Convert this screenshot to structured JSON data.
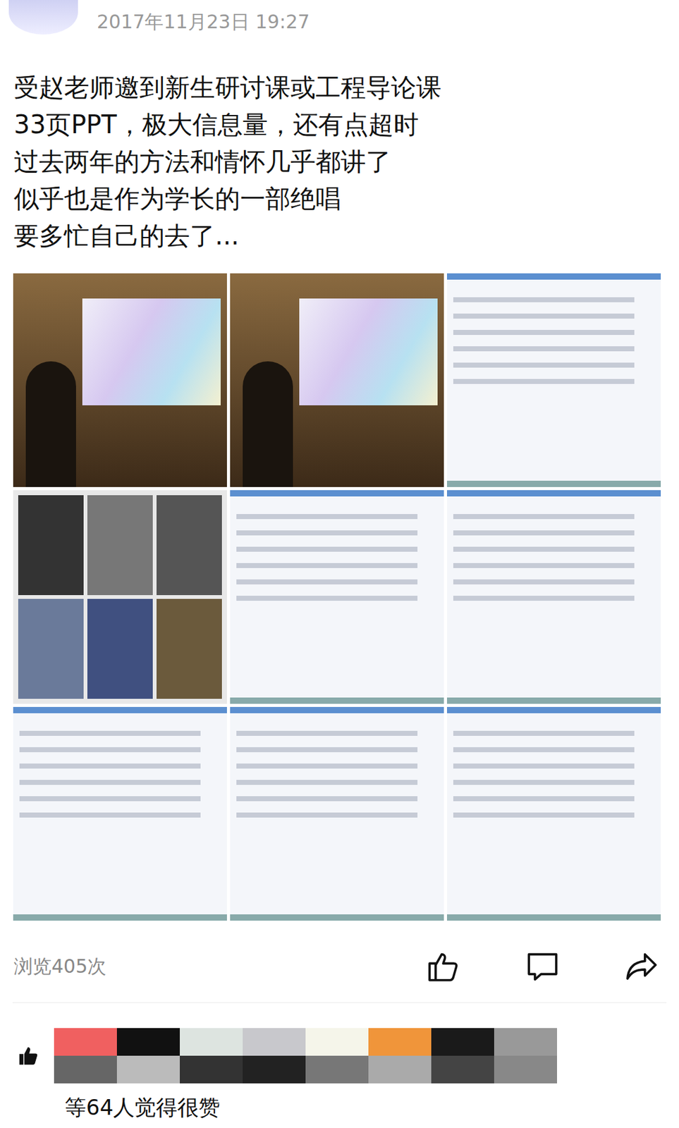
{
  "post": {
    "time": "2017年11月23日 19:27",
    "lines": [
      "受赵老师邀到新生研讨课或工程导论课",
      "33页PPT，极大信息量，还有点超时",
      "过去两年的方法和情怀几乎都讲了",
      "似乎也是作为学长的一部绝唱",
      "要多忙自己的去了..."
    ]
  },
  "photos": [
    {
      "kind": "lecture"
    },
    {
      "kind": "lecture"
    },
    {
      "kind": "slide"
    },
    {
      "kind": "collage"
    },
    {
      "kind": "slide"
    },
    {
      "kind": "slide"
    },
    {
      "kind": "slide"
    },
    {
      "kind": "slide"
    },
    {
      "kind": "slide"
    }
  ],
  "stats": {
    "views": "浏览405次"
  },
  "likes": {
    "summary": "等64人觉得很赞"
  }
}
